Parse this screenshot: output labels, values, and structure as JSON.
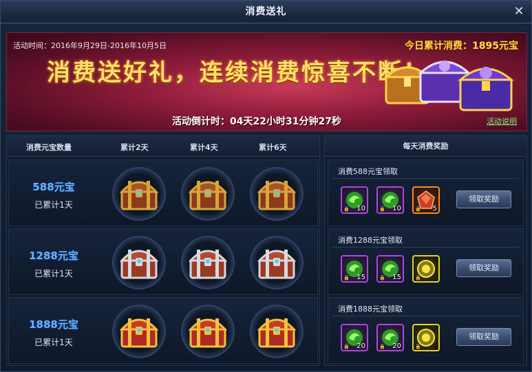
{
  "window": {
    "title": "消费送礼",
    "close_glyph": "✕"
  },
  "banner": {
    "date_range": "活动时间：2016年9月29日-2016年10月5日",
    "today_spend": "今日累计消费：1895元宝",
    "slogan": "消费送好礼，连续消费惊喜不断！",
    "countdown": "活动倒计时：04天22小时31分钟27秒",
    "help_link": "活动说明"
  },
  "table": {
    "headers": [
      "消费元宝数量",
      "累计2天",
      "累计4天",
      "累计6天"
    ],
    "rows": [
      {
        "amount": "588元宝",
        "accumulated": "已累计1天",
        "chest_style": "bronze"
      },
      {
        "amount": "1288元宝",
        "accumulated": "已累计1天",
        "chest_style": "silver"
      },
      {
        "amount": "1888元宝",
        "accumulated": "已累计1天",
        "chest_style": "gold"
      }
    ]
  },
  "daily": {
    "header": "每天消费奖励",
    "rewards": [
      {
        "title": "消费588元宝领取",
        "items": [
          {
            "icon": "green-swirl-icon",
            "rarity": "purple",
            "count": "10"
          },
          {
            "icon": "green-swirl-icon",
            "rarity": "purple",
            "count": "10"
          },
          {
            "icon": "red-gem-icon",
            "rarity": "orange",
            "count": "5"
          }
        ],
        "button": "领取奖励"
      },
      {
        "title": "消费1288元宝领取",
        "items": [
          {
            "icon": "green-swirl-icon",
            "rarity": "purple",
            "count": "15"
          },
          {
            "icon": "green-swirl-icon",
            "rarity": "purple",
            "count": "15"
          },
          {
            "icon": "gold-coin-icon",
            "rarity": "gold",
            "count": ""
          }
        ],
        "button": "领取奖励"
      },
      {
        "title": "消费1888元宝领取",
        "items": [
          {
            "icon": "green-swirl-icon",
            "rarity": "purple",
            "count": "20"
          },
          {
            "icon": "green-swirl-icon",
            "rarity": "purple",
            "count": "20"
          },
          {
            "icon": "gold-coin-icon",
            "rarity": "gold",
            "count": ""
          }
        ],
        "button": "领取奖励"
      }
    ]
  },
  "colors": {
    "amount": "#64b4ff",
    "today_spend": "#ffd94a",
    "help_link": "#7df07a"
  }
}
